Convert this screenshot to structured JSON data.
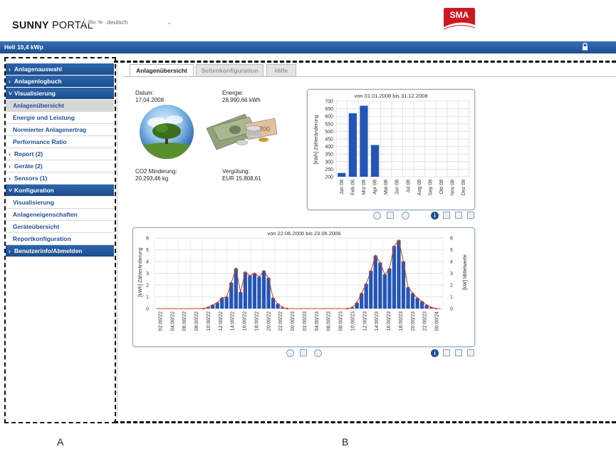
{
  "header": {
    "brand_bold": "SUNNY",
    "brand_light": " PORTAL",
    "language": "deutsch",
    "logo_text": "SMA"
  },
  "titlebar": {
    "plant_name": "Heli 10,4 kWp"
  },
  "sidebar": {
    "items": [
      {
        "label": "Anlagenauswahl",
        "kind": "main",
        "chevron": "›"
      },
      {
        "label": "Anlagenlogbuch",
        "kind": "main",
        "chevron": "›"
      },
      {
        "label": "Visualisierung",
        "kind": "main",
        "chevron": "˅"
      },
      {
        "label": "Anlagenübersicht",
        "kind": "sub",
        "active": true
      },
      {
        "label": "Energie und Leistung",
        "kind": "sub"
      },
      {
        "label": "Normierter Anlagenertrag",
        "kind": "sub"
      },
      {
        "label": "Performance Ratio",
        "kind": "sub"
      },
      {
        "label": "Report (2)",
        "kind": "cat",
        "chevron": "›"
      },
      {
        "label": "Geräte (2)",
        "kind": "cat",
        "chevron": "›"
      },
      {
        "label": "Sensors (1)",
        "kind": "cat",
        "chevron": "›"
      },
      {
        "label": "Konfiguration",
        "kind": "main",
        "chevron": "˅"
      },
      {
        "label": "Visualisierung",
        "kind": "sub"
      },
      {
        "label": "Anlageneigenschaften",
        "kind": "sub"
      },
      {
        "label": "Geräteübersicht",
        "kind": "sub"
      },
      {
        "label": "Reportkonfiguration",
        "kind": "sub"
      },
      {
        "label": "Benutzerinfo/Abmelden",
        "kind": "main",
        "chevron": "›"
      }
    ]
  },
  "tabs": [
    {
      "label": "Anlagenübersicht",
      "active": true
    },
    {
      "label": "Seitenkonfiguration",
      "active": false
    },
    {
      "label": "Hilfe",
      "active": false
    }
  ],
  "overview": {
    "date_label": "Datum:",
    "date_value": "17.04.2008",
    "energy_label": "Energie:",
    "energy_value": "28.990,66 kWh",
    "co2_label": "CO2 Minderung:",
    "co2_value": "20.293,46 kg",
    "payment_label": "Vergütung:",
    "payment_value": "EUR 15.808,61"
  },
  "colors": {
    "brand_blue": "#1d4f91",
    "bar_blue": "#2354b8",
    "curve": "#cc3b1b",
    "sma_red": "#cd1a21"
  },
  "icons": [
    "lock-icon",
    "globe-icon",
    "tree-image",
    "money-image",
    "prev-icon",
    "calendar-icon",
    "next-icon",
    "info-icon",
    "print-icon",
    "export-icon",
    "fullscreen-icon"
  ],
  "captions": {
    "a": "A",
    "b": "B"
  },
  "chart_data": [
    {
      "type": "bar",
      "title": "von 01.01.2008 bis 31.12.2008",
      "ylabel": "[kWh] Zähleränderung",
      "categories": [
        "Jan 08",
        "Feb 08",
        "Mrz 08",
        "Apr 08",
        "Mai 08",
        "Jun 08",
        "Jul 08",
        "Aug 08",
        "Sep 08",
        "Okt 08",
        "Nov 08",
        "Dez 08"
      ],
      "values": [
        225,
        620,
        670,
        410,
        null,
        null,
        null,
        null,
        null,
        null,
        null,
        null
      ],
      "ylim": [
        200,
        700
      ],
      "yticks": [
        "200",
        "250",
        "300",
        "350",
        "400",
        "450",
        "500",
        "550",
        "600",
        "650",
        "700"
      ],
      "grid": true
    },
    {
      "type": "bar",
      "title": "von 22.06.2006 bis 23.06.2006",
      "ylabel": "[kWh] Zähleränderung",
      "y2label": "[kW] Mittelwerte",
      "categories": [
        "02:00/22",
        "04:00/22",
        "06:00/22",
        "08:00/22",
        "10:00/22",
        "12:00/22",
        "14:00/22",
        "16:00/22",
        "18:00/22",
        "20:00/22",
        "22:00/22",
        "00:00/23",
        "02:00/23",
        "04:00/23",
        "06:00/23",
        "08:00/23",
        "10:00/23",
        "12:00/23",
        "14:00/23",
        "16:00/23",
        "18:00/23",
        "20:00/23",
        "22:00/23",
        "00:00/24"
      ],
      "values": [
        0,
        0,
        0,
        0,
        0,
        0,
        0,
        0,
        0,
        0,
        0,
        0.1,
        0.3,
        0.5,
        0.9,
        1.0,
        2.2,
        3.4,
        1.4,
        3.1,
        2.8,
        3.0,
        2.7,
        3.2,
        2.6,
        0.9,
        0.4,
        0.1,
        0,
        0,
        0,
        0,
        0,
        0,
        0,
        0,
        0,
        0,
        0,
        0,
        0,
        0,
        0.1,
        0.5,
        1.3,
        2.1,
        3.2,
        4.5,
        3.9,
        2.9,
        3.4,
        5.3,
        5.8,
        4.0,
        1.8,
        1.3,
        0.9,
        0.6,
        0.3,
        0.1,
        0,
        0
      ],
      "ylim": [
        0,
        6
      ],
      "yticks": [
        "0",
        "1",
        "2",
        "3",
        "4",
        "5",
        "6"
      ],
      "grid": true
    }
  ]
}
